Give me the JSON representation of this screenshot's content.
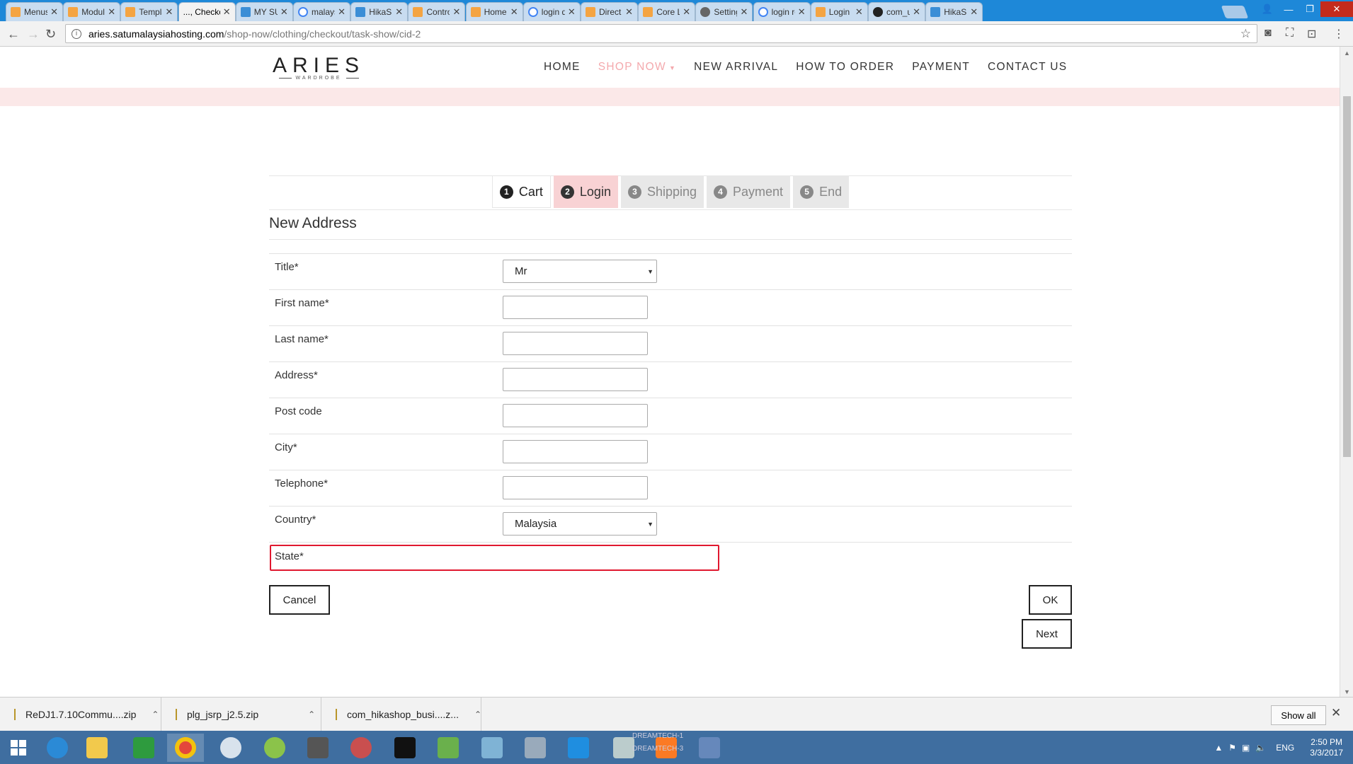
{
  "browser": {
    "tabs": [
      {
        "label": "Menus:",
        "icon": "joomla"
      },
      {
        "label": "Module",
        "icon": "joomla"
      },
      {
        "label": "Templa",
        "icon": "joomla"
      },
      {
        "label": "..., Checko",
        "icon": "none",
        "active": true
      },
      {
        "label": "MY SUI",
        "icon": "star"
      },
      {
        "label": "malays",
        "icon": "g"
      },
      {
        "label": "HikaSh",
        "icon": "star"
      },
      {
        "label": "Contro",
        "icon": "joomla"
      },
      {
        "label": "Home",
        "icon": "joomla"
      },
      {
        "label": "login di",
        "icon": "g"
      },
      {
        "label": "Direct A",
        "icon": "joomla"
      },
      {
        "label": "Core Lo",
        "icon": "joomla"
      },
      {
        "label": "Setting",
        "icon": "gear"
      },
      {
        "label": "login re",
        "icon": "g"
      },
      {
        "label": "Login R",
        "icon": "joomla"
      },
      {
        "label": "com_us",
        "icon": "gh"
      },
      {
        "label": "HikaSh",
        "icon": "star"
      }
    ],
    "tab_close": "✕",
    "url_host": "aries.satumalaysiahosting.com",
    "url_path": "/shop-now/clothing/checkout/task-show/cid-2"
  },
  "site": {
    "logo_word": "ARIES",
    "logo_sub": "WARDROBE",
    "menu": [
      {
        "label": "HOME",
        "active": false
      },
      {
        "label": "SHOP NOW",
        "active": true
      },
      {
        "label": "NEW ARRIVAL",
        "active": false
      },
      {
        "label": "HOW TO ORDER",
        "active": false
      },
      {
        "label": "PAYMENT",
        "active": false
      },
      {
        "label": "CONTACT US",
        "active": false
      }
    ]
  },
  "checkout": {
    "steps": [
      {
        "num": "1",
        "label": "Cart",
        "state": "done"
      },
      {
        "num": "2",
        "label": "Login",
        "state": "current"
      },
      {
        "num": "3",
        "label": "Shipping",
        "state": "todo"
      },
      {
        "num": "4",
        "label": "Payment",
        "state": "todo"
      },
      {
        "num": "5",
        "label": "End",
        "state": "todo"
      }
    ],
    "section_title": "New Address",
    "fields": {
      "title": {
        "label": "Title*",
        "value": "Mr"
      },
      "first_name": {
        "label": "First name*",
        "value": ""
      },
      "last_name": {
        "label": "Last name*",
        "value": ""
      },
      "address": {
        "label": "Address*",
        "value": ""
      },
      "post_code": {
        "label": "Post code",
        "value": ""
      },
      "city": {
        "label": "City*",
        "value": ""
      },
      "telephone": {
        "label": "Telephone*",
        "value": ""
      },
      "country": {
        "label": "Country*",
        "value": "Malaysia"
      },
      "state": {
        "label": "State*"
      }
    },
    "buttons": {
      "cancel": "Cancel",
      "ok": "OK",
      "next": "Next"
    },
    "highlight_color": "#e0182f"
  },
  "downloads": {
    "items": [
      "ReDJ1.7.10Commu....zip",
      "plg_jsrp_j2.5.zip",
      "com_hikashop_busi....z..."
    ],
    "show_all": "Show all"
  },
  "taskbar": {
    "time": "2:50 PM",
    "date": "3/3/2017",
    "lang": "ENG",
    "overlay_text_1": "DREAMTECH-1",
    "overlay_text_2": "DREAMTECH-3"
  }
}
